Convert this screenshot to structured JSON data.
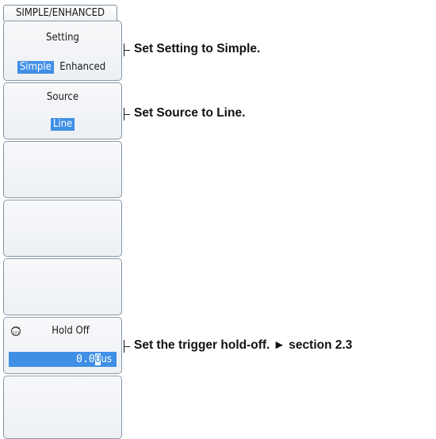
{
  "menu": {
    "title": "SIMPLE/ENHANCED",
    "setting": {
      "label": "Setting",
      "options": [
        "Simple",
        "Enhanced"
      ],
      "selected": "Simple"
    },
    "source": {
      "label": "Source",
      "value": "Line"
    },
    "hold_off": {
      "label": "Hold Off",
      "icon": "jog-dial-icon",
      "value_prefix": "0.0",
      "value_cursor_digit": "0",
      "value_unit": "us"
    }
  },
  "callouts": {
    "setting": "Set Setting to Simple.",
    "source": "Set Source to Line.",
    "hold_off": "Set the trigger hold-off. ► section 2.3"
  },
  "colors": {
    "highlight": "#3f8fe6",
    "key_border": "#8797a6"
  }
}
